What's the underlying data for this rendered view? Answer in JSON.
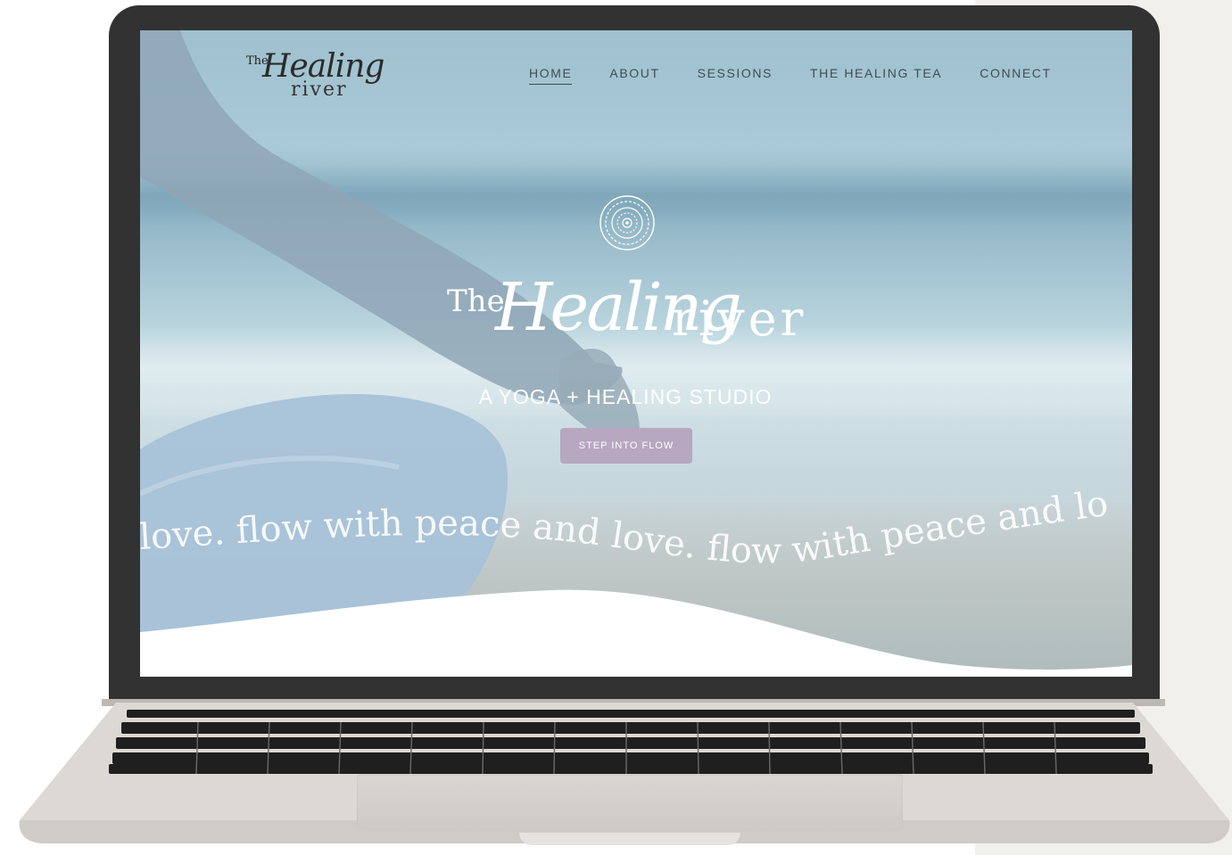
{
  "brand": {
    "logo_the": "The",
    "logo_healing": "Healing",
    "logo_river": "river"
  },
  "nav": {
    "items": [
      {
        "label": "HOME",
        "active": true
      },
      {
        "label": "ABOUT",
        "active": false
      },
      {
        "label": "SESSIONS",
        "active": false
      },
      {
        "label": "THE HEALING TEA",
        "active": false
      },
      {
        "label": "CONNECT",
        "active": false
      }
    ]
  },
  "hero": {
    "logo_the": "The",
    "logo_healing": "Healing",
    "logo_river": "river",
    "tagline": "A YOGA + HEALING STUDIO",
    "cta_label": "STEP INTO FLOW",
    "flow_text": "love.    flow with peace and love.    flow with peace and lo"
  },
  "colors": {
    "cta_bg": "#b7a7c1",
    "nav_text": "#3e4d57",
    "laptop_bezel": "#323232"
  },
  "icons": {
    "mandala": "mandala-icon"
  }
}
